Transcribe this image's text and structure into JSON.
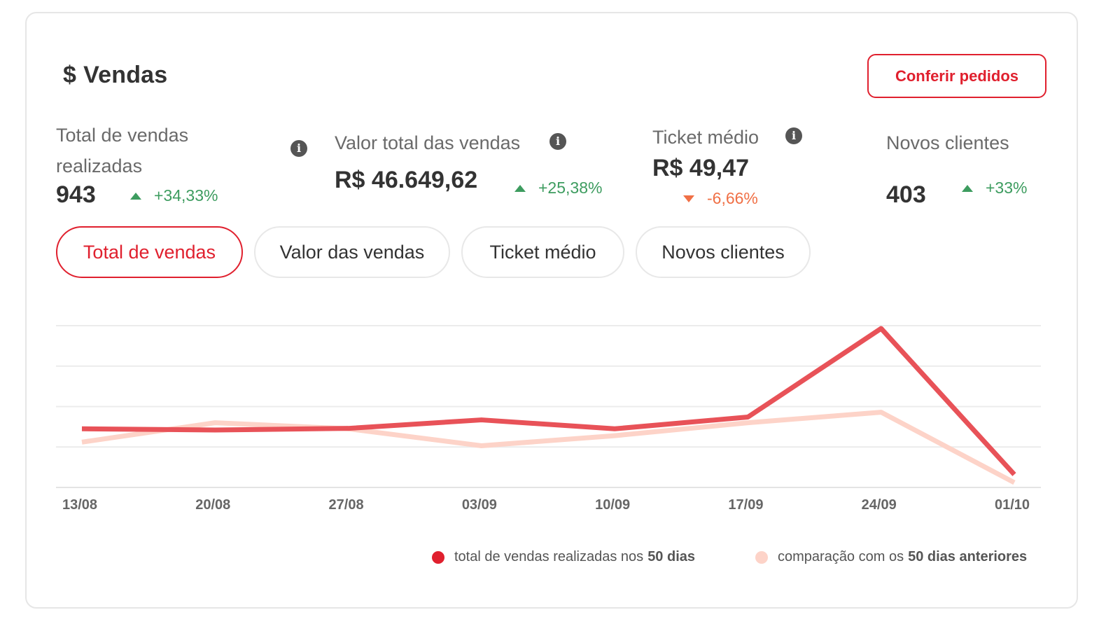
{
  "header": {
    "currency_symbol": "$",
    "title": "Vendas",
    "cta_label": "Conferir pedidos"
  },
  "metrics": [
    {
      "label_line1": "Total de vendas",
      "label_line2": "realizadas",
      "value": "943",
      "delta": "+34,33%",
      "trend": "up",
      "info_icon": "info-icon"
    },
    {
      "label": "Valor total das vendas",
      "value": "R$ 46.649,62",
      "delta": "+25,38%",
      "trend": "up",
      "info_icon": "info-icon"
    },
    {
      "label": "Ticket médio",
      "value": "R$ 49,47",
      "delta": "-6,66%",
      "trend": "down",
      "info_icon": "info-icon"
    },
    {
      "label": "Novos clientes",
      "value": "403",
      "delta": "+33%",
      "trend": "up"
    }
  ],
  "tabs": [
    {
      "label": "Total de vendas",
      "active": true
    },
    {
      "label": "Valor das vendas",
      "active": false
    },
    {
      "label": "Ticket médio",
      "active": false
    },
    {
      "label": "Novos clientes",
      "active": false
    }
  ],
  "colors": {
    "accent": "#e0202e",
    "current_series": "#e85258",
    "previous_series": "#fdd3c8",
    "positive": "#3d9c5f",
    "negative": "#f07046"
  },
  "chart_data": {
    "type": "line",
    "x": [
      "13/08",
      "20/08",
      "27/08",
      "03/09",
      "10/09",
      "17/09",
      "24/09",
      "01/10"
    ],
    "ylim": [
      0,
      4
    ],
    "grid": true,
    "series": [
      {
        "name": "total de vendas realizadas nos 50 dias",
        "values": [
          1.45,
          1.42,
          1.46,
          1.67,
          1.45,
          1.74,
          3.93,
          0.32
        ]
      },
      {
        "name": "comparação com os 50 dias anteriores",
        "values": [
          1.12,
          1.6,
          1.45,
          1.03,
          1.28,
          1.6,
          1.86,
          0.12
        ]
      }
    ]
  },
  "legend": [
    {
      "text": "total de vendas realizadas nos",
      "bold": "50 dias"
    },
    {
      "text": "comparação com os",
      "bold": "50 dias anteriores"
    }
  ]
}
